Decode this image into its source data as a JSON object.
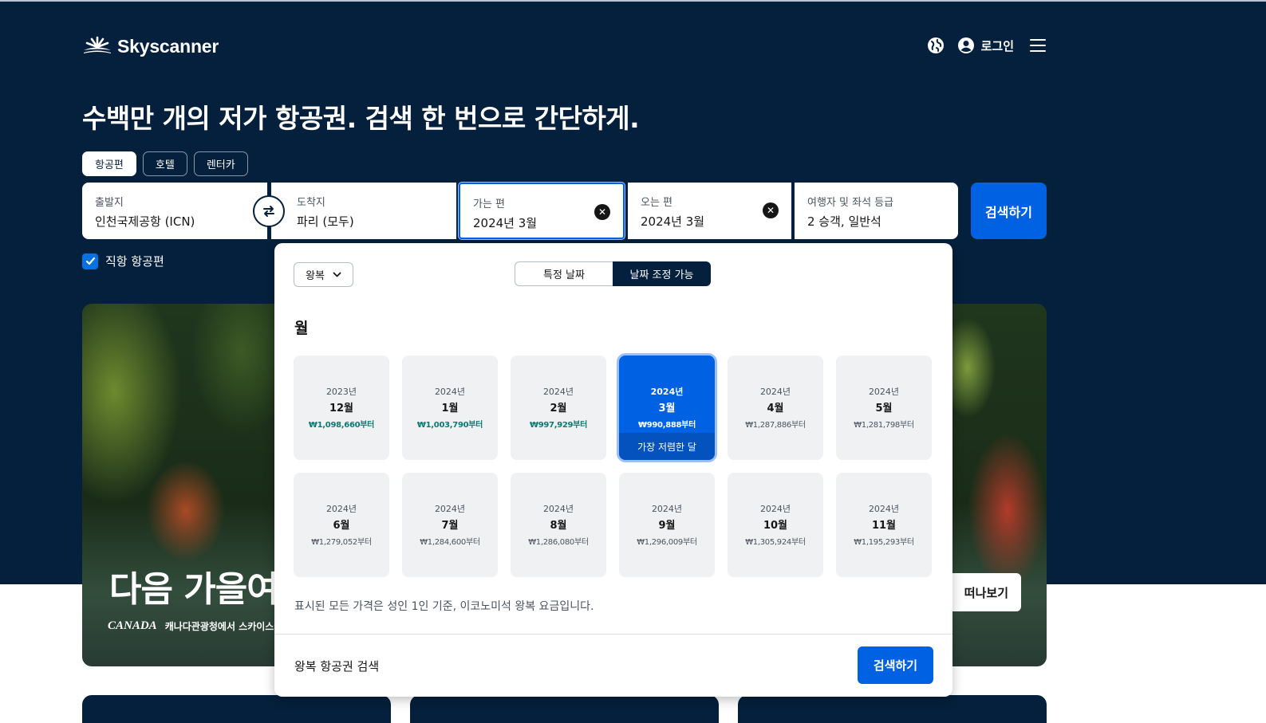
{
  "brand": {
    "name": "Skyscanner"
  },
  "header": {
    "login_label": "로그인"
  },
  "headline": "수백만 개의 저가 항공권. 검색 한 번으로 간단하게.",
  "tabs": [
    {
      "label": "항공편",
      "active": true
    },
    {
      "label": "호텔",
      "active": false
    },
    {
      "label": "렌터카",
      "active": false
    }
  ],
  "search": {
    "origin": {
      "label": "출발지",
      "value": "인천국제공항 (ICN)"
    },
    "destination": {
      "label": "도착지",
      "value": "파리 (모두)"
    },
    "depart": {
      "label": "가는 편",
      "value": "2024년 3월"
    },
    "return": {
      "label": "오는 편",
      "value": "2024년 3월"
    },
    "travellers": {
      "label": "여행자 및 좌석 등급",
      "value": "2 승객, 일반석"
    },
    "button_label": "검색하기",
    "direct_label": "직항 항공편",
    "direct_checked": true
  },
  "banner": {
    "title": "다음 가을여",
    "sponsor_logo": "CANADA",
    "sponsor_text": "캐나다관광청에서 스카이스캐너",
    "button_label": "떠나보기"
  },
  "panel": {
    "trip_type": "왕복",
    "segments": {
      "specific": "특정 날짜",
      "flexible": "날짜 조정 가능",
      "active": "flexible"
    },
    "months_heading": "월",
    "months": [
      {
        "year": "2023년",
        "month": "12월",
        "price": "₩1,098,660부터",
        "cheap": true
      },
      {
        "year": "2024년",
        "month": "1월",
        "price": "₩1,003,790부터",
        "cheap": true
      },
      {
        "year": "2024년",
        "month": "2월",
        "price": "₩997,929부터",
        "cheap": true
      },
      {
        "year": "2024년",
        "month": "3월",
        "price": "₩990,888부터",
        "selected": true,
        "tag": "가장 저렴한 달"
      },
      {
        "year": "2024년",
        "month": "4월",
        "price": "₩1,287,886부터"
      },
      {
        "year": "2024년",
        "month": "5월",
        "price": "₩1,281,798부터"
      },
      {
        "year": "2024년",
        "month": "6월",
        "price": "₩1,279,052부터"
      },
      {
        "year": "2024년",
        "month": "7월",
        "price": "₩1,284,600부터"
      },
      {
        "year": "2024년",
        "month": "8월",
        "price": "₩1,286,080부터"
      },
      {
        "year": "2024년",
        "month": "9월",
        "price": "₩1,296,009부터"
      },
      {
        "year": "2024년",
        "month": "10월",
        "price": "₩1,305,924부터"
      },
      {
        "year": "2024년",
        "month": "11월",
        "price": "₩1,195,293부터"
      }
    ],
    "note": "표시된 모든 가격은 성인 1인 기준, 이코노미석 왕복 요금입니다.",
    "footer_text": "왕복 항공권 검색",
    "search_label": "검색하기"
  },
  "colors": {
    "navy": "#05203c",
    "primary": "#0062e3",
    "cheap_price": "#0b7a73"
  }
}
